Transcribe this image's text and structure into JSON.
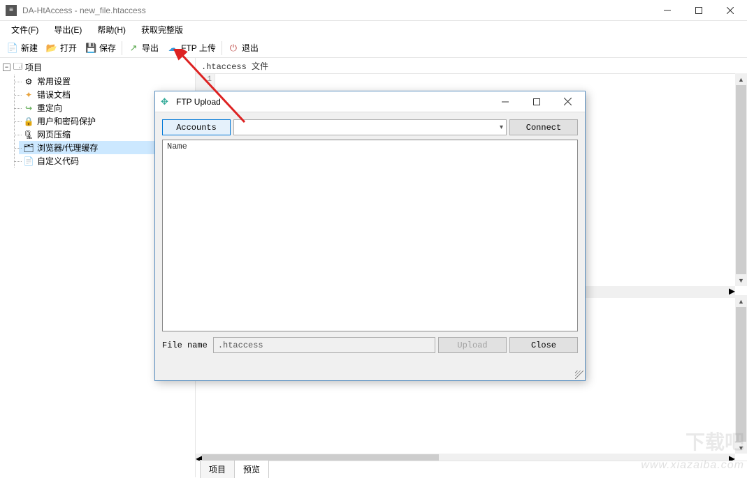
{
  "window": {
    "title": "DA-HtAccess - new_file.htaccess"
  },
  "menubar": {
    "file": "文件(F)",
    "export": "导出(E)",
    "help": "帮助(H)",
    "getfull": "获取完整版"
  },
  "toolbar": {
    "new": "新建",
    "open": "打开",
    "save": "保存",
    "export": "导出",
    "ftp_upload": "FTP 上传",
    "exit": "退出"
  },
  "tree": {
    "root": "项目",
    "items": [
      {
        "icon": "⚙",
        "label": "常用设置"
      },
      {
        "icon": "✦",
        "label": "错误文档"
      },
      {
        "icon": "↪",
        "label": "重定向"
      },
      {
        "icon": "🔒",
        "label": "用户和密码保护"
      },
      {
        "icon": "🗜",
        "label": "网页压缩"
      },
      {
        "icon": "🗂",
        "label": "浏览器/代理缓存",
        "selected": true
      },
      {
        "icon": "📄",
        "label": "自定义代码"
      }
    ]
  },
  "editor": {
    "header": ".htaccess 文件",
    "line1": "1"
  },
  "bottom_tabs": {
    "project": "项目",
    "preview": "预览"
  },
  "dialog": {
    "title": "FTP Upload",
    "accounts_btn": "Accounts",
    "connect_btn": "Connect",
    "list_header": "Name",
    "filename_label": "File name",
    "filename_value": ".htaccess",
    "upload_btn": "Upload",
    "close_btn": "Close"
  },
  "watermark": {
    "site": "www.xiazaiba.com",
    "logo": "下载吧"
  }
}
